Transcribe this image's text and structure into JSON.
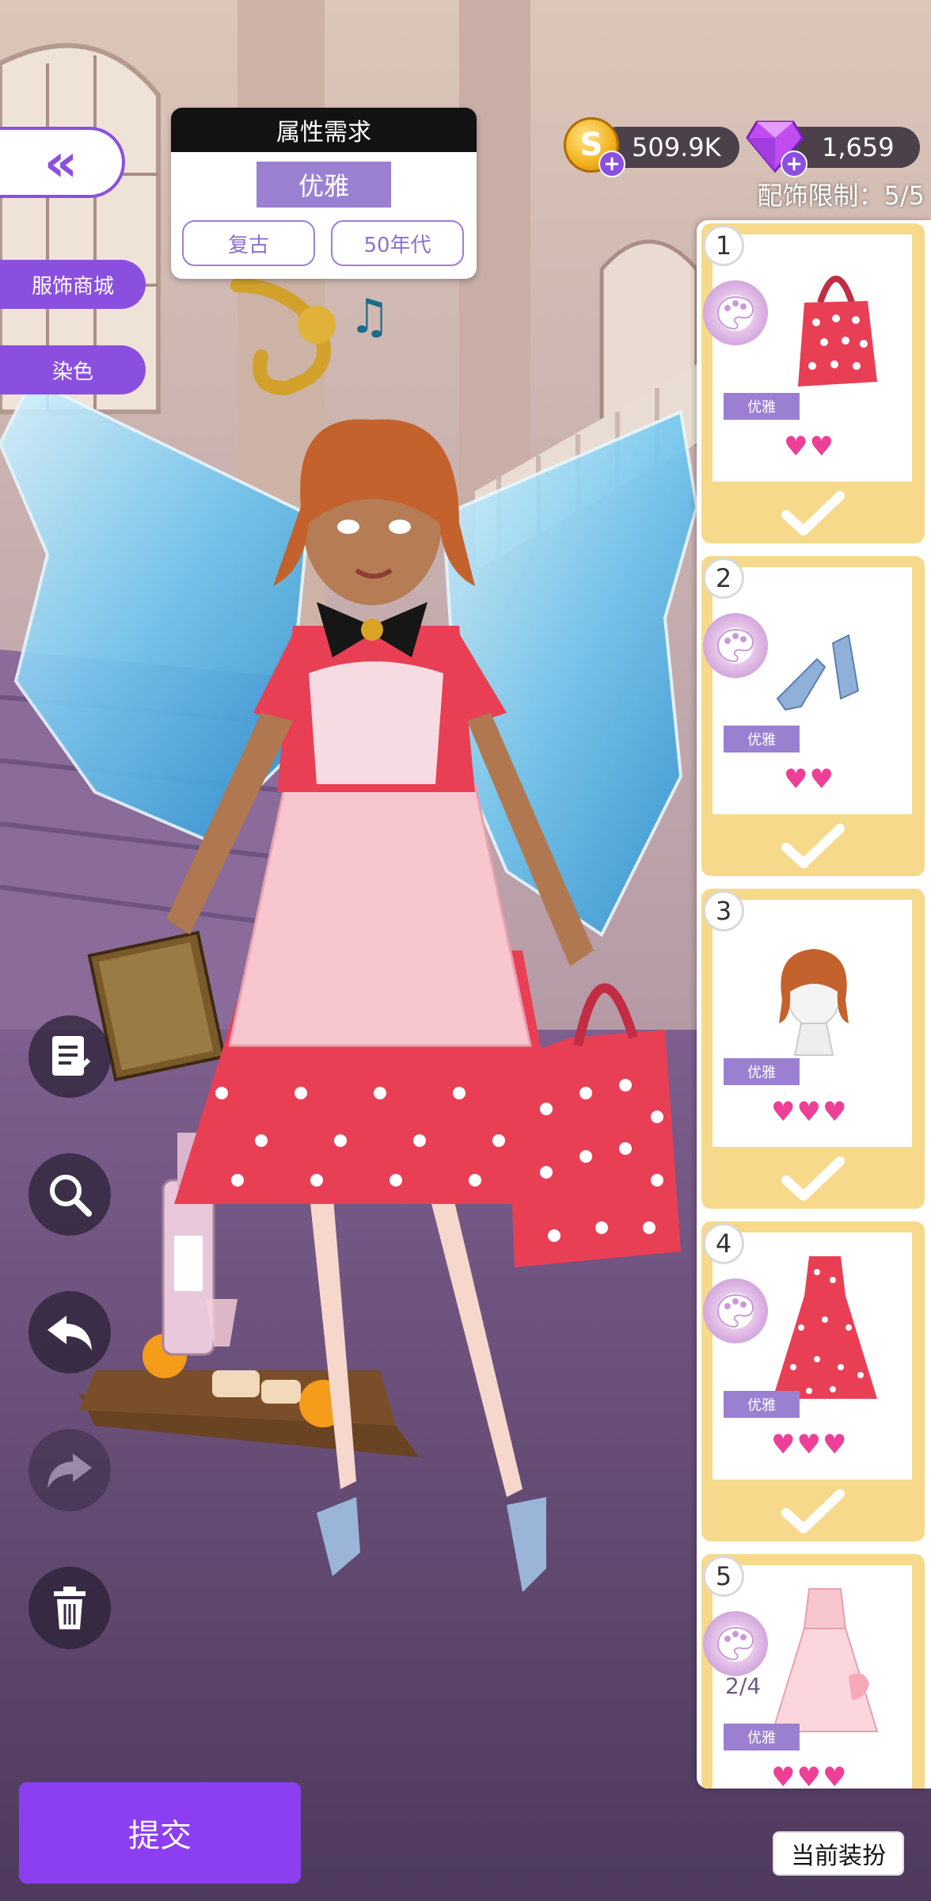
{
  "back_button": {
    "icon": "double-chevron-left-icon"
  },
  "side_menu": {
    "shop_label": "服饰商城",
    "dye_label": "染色"
  },
  "requirements": {
    "title": "属性需求",
    "main_tag": "优雅",
    "tags": [
      "复古",
      "50年代"
    ]
  },
  "currency": {
    "coins": "509.9K",
    "gems": "1,659",
    "coin_icon": "coin-icon",
    "gem_icon": "diamond-icon"
  },
  "accessory_limit": "配饰限制：5/5",
  "slots": [
    {
      "number": "1",
      "tag": "优雅",
      "hearts": "♥♥",
      "item_icon": "polka-dot-tote-bag-icon",
      "checked": true,
      "palette": true
    },
    {
      "number": "2",
      "tag": "优雅",
      "hearts": "♥♥",
      "item_icon": "blue-heels-icon",
      "checked": true,
      "palette": true
    },
    {
      "number": "3",
      "tag": "优雅",
      "hearts": "♥♥♥",
      "item_icon": "bob-hairstyle-icon",
      "checked": true,
      "palette": false
    },
    {
      "number": "4",
      "tag": "优雅",
      "hearts": "♥♥♥",
      "item_icon": "polka-dot-dress-icon",
      "checked": true,
      "palette": true
    },
    {
      "number": "5",
      "tag": "优雅",
      "hearts": "♥♥♥",
      "item_icon": "pink-apron-dress-icon",
      "checked": false,
      "palette": true,
      "progress": "2/4"
    }
  ],
  "tools": [
    "notes-icon",
    "zoom-icon",
    "undo-icon",
    "redo-icon",
    "trash-icon"
  ],
  "submit_label": "提交",
  "current_outfit_label": "当前装扮",
  "colors": {
    "accent": "#8b4fe0",
    "tag": "#9b80d2",
    "heart": "#ee3f97",
    "slot_bg": "#f6d98a"
  }
}
